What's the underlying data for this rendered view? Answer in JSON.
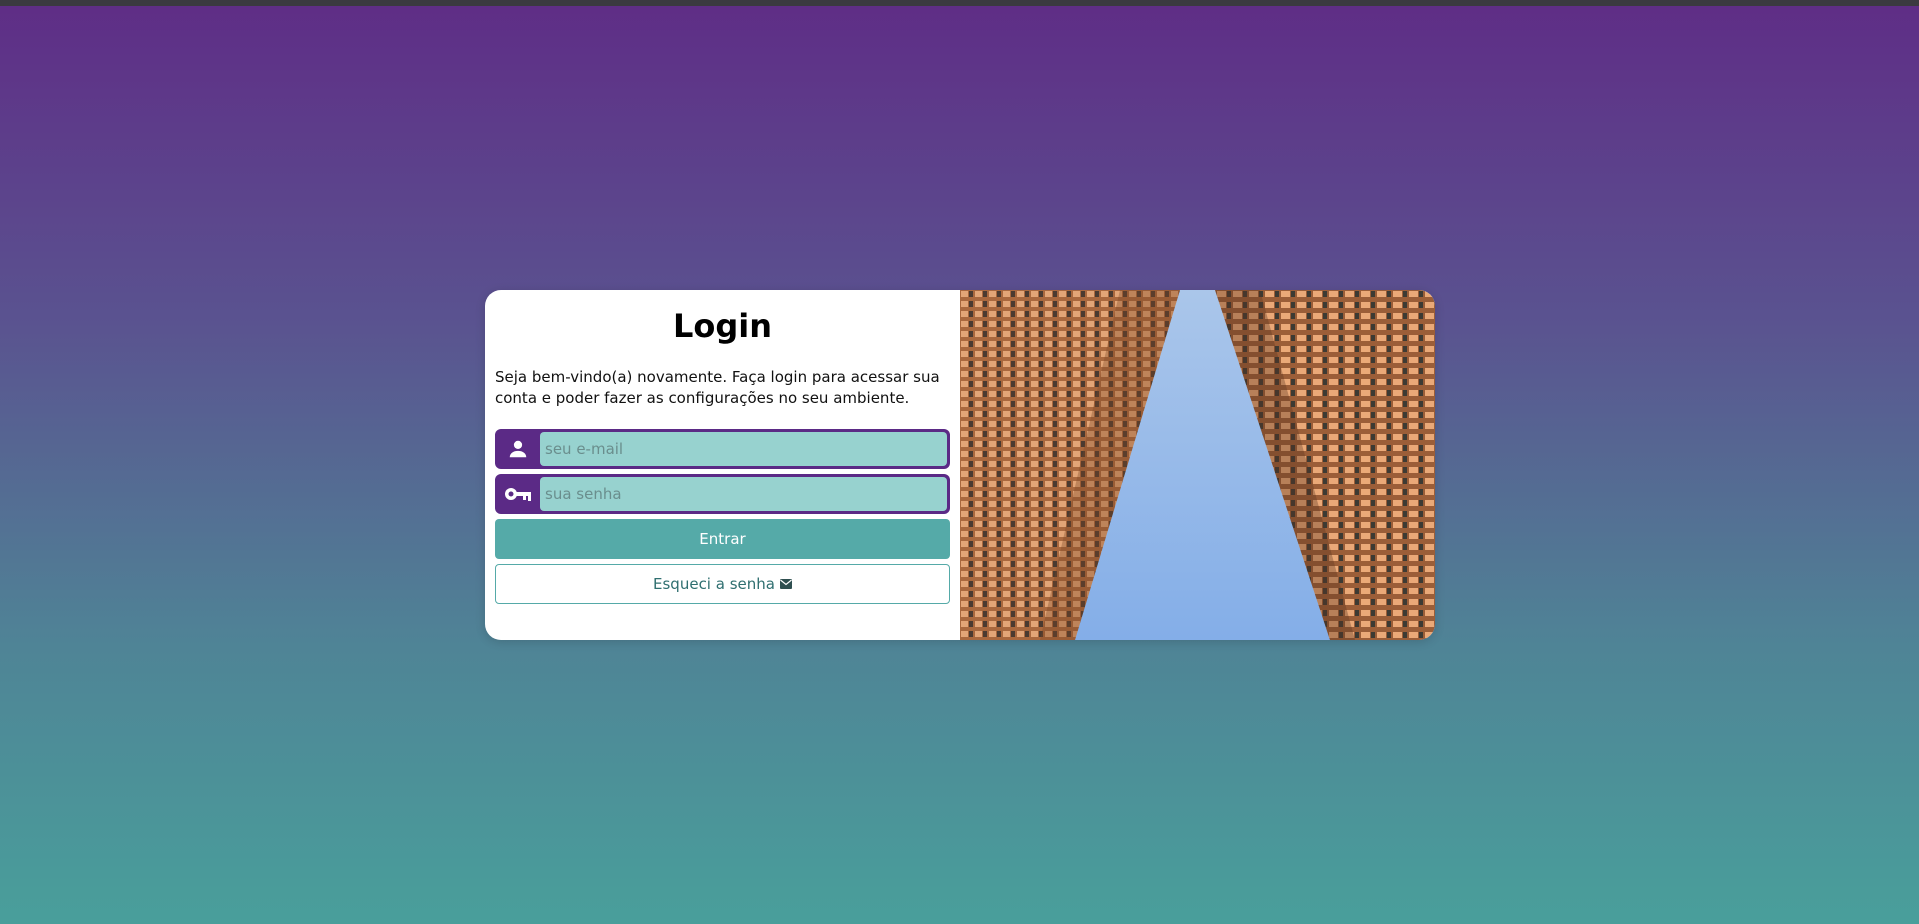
{
  "login": {
    "title": "Login",
    "description": "Seja bem-vindo(a) novamente. Faça login para acessar sua conta e poder fazer as configurações no seu ambiente.",
    "email_placeholder": "seu e-mail",
    "password_placeholder": "sua senha",
    "submit_label": "Entrar",
    "forgot_label": "Esqueci a senha"
  },
  "icons": {
    "email_field": "user-icon",
    "password_field": "key-icon",
    "forgot": "envelope-icon"
  },
  "colors": {
    "field_frame": "#5b2a86",
    "field_input_bg": "#97d2cf",
    "primary_button": "#55aaa8",
    "gradient_top": "#5f2d86",
    "gradient_bottom": "#499f9b"
  }
}
